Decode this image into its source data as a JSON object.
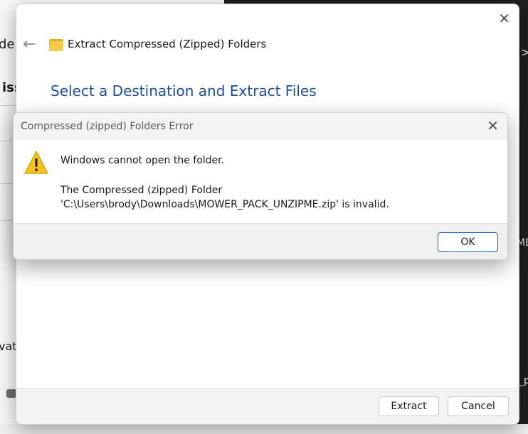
{
  "background": {
    "left_fragments": [
      "der",
      "iss",
      "vat"
    ],
    "right_fragments": [
      ">",
      "ME",
      "_p"
    ]
  },
  "wizard": {
    "title": "Extract Compressed (Zipped) Folders",
    "heading": "Select a Destination and Extract Files",
    "extract_label": "Extract",
    "cancel_label": "Cancel",
    "close_glyph": "✕",
    "back_glyph": "←"
  },
  "error_dialog": {
    "title": "Compressed (zipped) Folders Error",
    "message_primary": "Windows cannot open the folder.",
    "message_detail": "The Compressed (zipped) Folder 'C:\\Users\\brody\\Downloads\\MOWER_PACK_UNZIPME.zip' is invalid.",
    "ok_label": "OK",
    "close_glyph": "✕",
    "icon": "warning-icon"
  },
  "colors": {
    "heading": "#1d4f9a",
    "warning": "#f7c31c",
    "ok_border": "#1460c4"
  }
}
